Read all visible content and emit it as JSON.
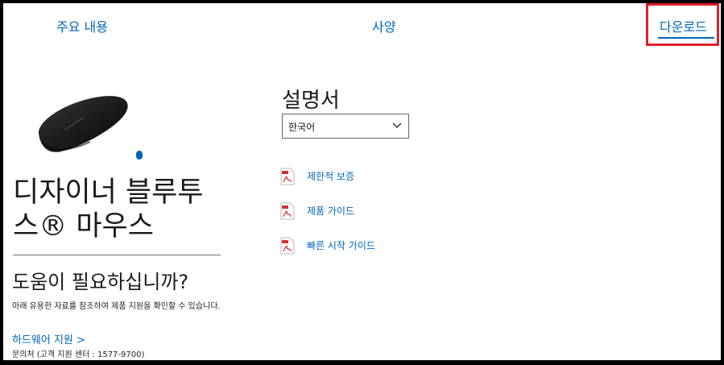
{
  "tabs": {
    "overview": "주요 내용",
    "specs": "사양",
    "downloads": "다운로드"
  },
  "product": {
    "title": "디자이너 블루투스® 마우스"
  },
  "help": {
    "heading": "도움이 필요하십니까?",
    "text": "아래 유용한 자료를 참조하여 제품 지원을 확인할 수 있습니다.",
    "hardware_link": "하드웨어 지원 >",
    "contact": "문의처 (고객 지원 센터 : 1577-9700)"
  },
  "manuals": {
    "heading": "설명서",
    "language_selected": "한국어",
    "documents": [
      {
        "label": "제한적 보증",
        "icon": "pdf-icon"
      },
      {
        "label": "제품 가이드",
        "icon": "pdf-icon"
      },
      {
        "label": "빠른 시작 가이드",
        "icon": "pdf-icon"
      }
    ]
  },
  "colors": {
    "link": "#0067b8",
    "highlight_box": "#e01e2b",
    "pdf_red": "#d32f2f"
  }
}
